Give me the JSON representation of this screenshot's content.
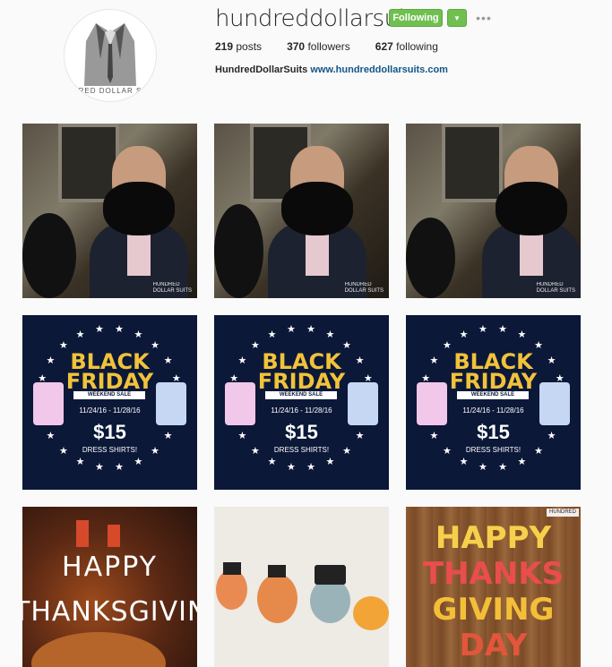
{
  "profile": {
    "username": "hundreddollarsuits",
    "avatar_text": "RED DOLLAR S",
    "follow_label": "Following",
    "dropdown_icon": "chevron-down-icon",
    "more_icon": "more-icon",
    "more_text": "•••",
    "posts_count": "219",
    "posts_label": "posts",
    "followers_count": "370",
    "followers_label": "followers",
    "following_count": "627",
    "following_label": "following",
    "bio_name": "HundredDollarSuits",
    "bio_link": "www.hundreddollarsuits.com"
  },
  "watermark": {
    "line1": "HUNDRED",
    "line2": "DOLLAR SUITS"
  },
  "black_friday": {
    "black": "BLACK",
    "friday": "FRIDAY",
    "weekend": "WEEKEND SALE",
    "dates": "11/24/16 - 11/28/16",
    "price": "$15",
    "dress": "DRESS SHIRTS!"
  },
  "thanksgiving": {
    "happy": "HAPPY",
    "tg": "THANKSGIVIN"
  },
  "wood": {
    "r1": "HAPPY",
    "r2": "THANKS",
    "r3": "GIVING",
    "r4": "DAY",
    "wm": "HUNDRED"
  },
  "colors": {
    "following_green": "#70c050",
    "link_blue": "#125688",
    "black_friday_navy": "#0b1838",
    "black_friday_gold": "#f1c23b"
  }
}
